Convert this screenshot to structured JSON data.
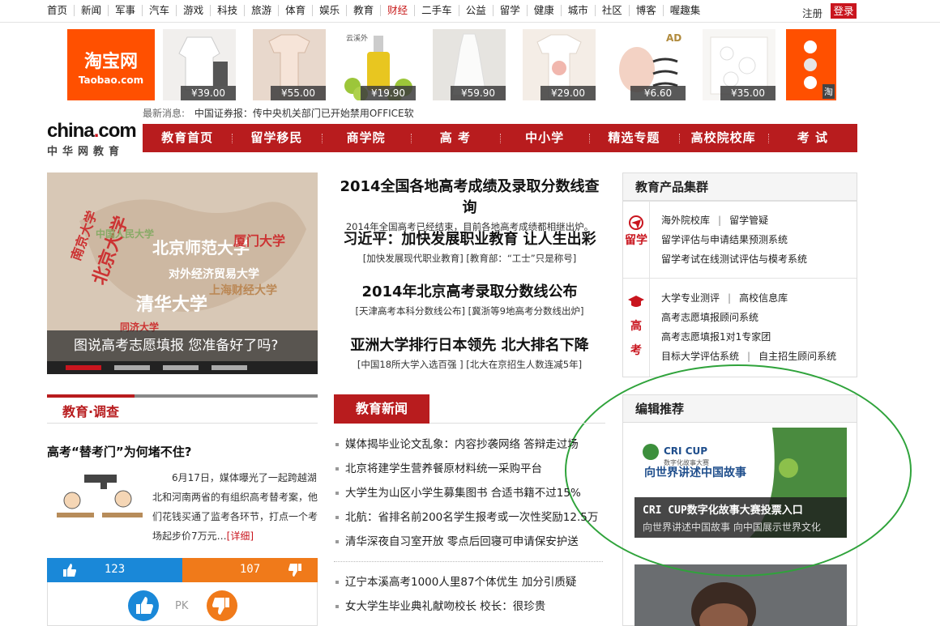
{
  "topnav": {
    "items": [
      "首页",
      "新闻",
      "军事",
      "汽车",
      "游戏",
      "科技",
      "旅游",
      "体育",
      "娱乐",
      "教育",
      "财经",
      "二手车",
      "公益",
      "留学",
      "健康",
      "城市",
      "社区",
      "博客",
      "喔趣集"
    ],
    "active_index": 10,
    "register": "注册",
    "login": "登录"
  },
  "ads": {
    "taobao_cn": "淘宝网",
    "taobao_en": "Taobao.com",
    "products": [
      {
        "price": "¥39.00"
      },
      {
        "price": "¥55.00"
      },
      {
        "price": "¥19.90",
        "brand": "云溪外"
      },
      {
        "price": "¥59.90"
      },
      {
        "price": "¥29.00"
      },
      {
        "price": "¥6.60",
        "brand": "AD"
      },
      {
        "price": "¥35.00"
      }
    ],
    "right_tag": "淘"
  },
  "ticker": {
    "label": "最新消息:",
    "text": "中国证券报：传中央机关部门已开始禁用OFFICE软"
  },
  "logo": {
    "main_a": "china",
    "main_dot": ".",
    "main_b": "com",
    "sub": "中华网教育"
  },
  "channel_nav": [
    "教育首页",
    "留学移民",
    "商学院",
    "高 考",
    "中小学",
    "精选专题",
    "高校院校库",
    "考 试"
  ],
  "hero": {
    "caption": "图说高考志愿填报 您准备好了吗?",
    "active_dot": 0,
    "dot_count": 4
  },
  "headlines": [
    {
      "title": "2014全国各地高考成绩及录取分数线查询",
      "sub": "2014年全国高考已经结束，目前各地高考成绩都相继出炉。"
    },
    {
      "title": "习近平：加快发展职业教育 让人生出彩",
      "sub": "[加快发展现代职业教育] [教育部：“工士”只是称号]"
    },
    {
      "title": "2014年北京高考录取分数线公布",
      "sub": "[天津高考本科分数线公布] [冀浙等9地高考分数线出炉]"
    },
    {
      "title": "亚洲大学排行日本领先 北大排名下降",
      "sub": "[中国18所大学入选百强 ] [北大在京招生人数连减5年]"
    }
  ],
  "products_box": {
    "title": "教育产品集群",
    "groups": [
      {
        "label": "留学",
        "lines": [
          [
            "海外院校库",
            "留学管疑"
          ],
          [
            "留学评估与申请结果预测系统"
          ],
          [
            "留学考试在线测试评估与模考系统"
          ]
        ]
      },
      {
        "label": "高考",
        "lines": [
          [
            "大学专业测评",
            "高校信息库"
          ],
          [
            "高考志愿填报顾问系统"
          ],
          [
            "高考志愿填报1对1专家团"
          ],
          [
            "目标大学评估系统",
            "自主招生顾问系统"
          ]
        ]
      }
    ]
  },
  "editor_box": {
    "title": "编辑推荐",
    "img_brand": "CRI CUP",
    "img_brand_sub": "数字化故事大赛",
    "img_slogan": "向世界讲述中国故事",
    "caption_title": "CRI CUP数字化故事大赛投票入口",
    "caption_sub": "向世界讲述中国故事 向中国展示世界文化"
  },
  "survey": {
    "tab": "教育·调查",
    "question": "高考“替考门”为何堵不住?",
    "text": "6月17日，媒体曝光了一起跨越湖北和河南两省的有组织高考替考案，他们花钱买通了监考各环节，打点一个考场起步价7万元…",
    "more": "[详细]",
    "yes_count": "123",
    "no_count": "107",
    "pk": "PK"
  },
  "news": {
    "tab": "教育新闻",
    "items": [
      "媒体揭毕业论文乱象：内容抄袭网络 答辩走过场",
      "北京将建学生营养餐原材料统一采购平台",
      "大学生为山区小学生募集图书 合适书籍不过15%",
      "北航：省排名前200名学生报考或一次性奖励12.5万",
      "清华深夜自习室开放 零点后回寝可申请保安护送"
    ],
    "items2": [
      "辽宁本溪高考1000人里87个体优生 加分引质疑",
      "女大学生毕业典礼献吻校长 校长：很珍贵"
    ]
  },
  "colors": {
    "brand_red": "#b81c1e",
    "taobao_orange": "#ff5000",
    "vote_blue": "#1a88d8",
    "vote_orange": "#f07a1a",
    "annotation_green": "#2fa33b"
  }
}
